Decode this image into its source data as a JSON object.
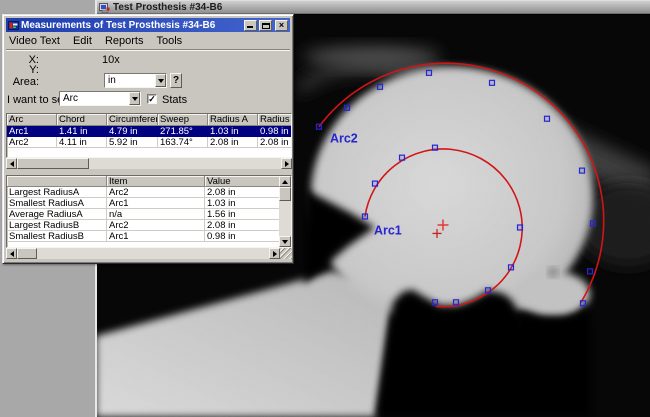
{
  "mdi_window": {
    "title": "Test Prosthesis #34-B6"
  },
  "dialog": {
    "title": "Measurements of Test Prosthesis #34-B6",
    "menu_items": [
      "Video Text",
      "Edit",
      "Reports",
      "Tools"
    ],
    "coords_panel": {
      "x_label": "X:",
      "y_label": "Y:",
      "magnification": "10x",
      "area_label": "Area:",
      "area_unit": "in",
      "help_label": "?"
    },
    "view_row": {
      "label": "I want to see:",
      "selected": "Arc",
      "stats_label": "Stats",
      "stats_checked": true
    },
    "arc_table": {
      "headers": [
        "Arc",
        "Chord",
        "Circumferenc",
        "Sweep",
        "Radius A",
        "Radius B"
      ],
      "rows": [
        {
          "cells": [
            "Arc1",
            "1.41 in",
            "4.79 in",
            "271.85°",
            "1.03 in",
            "0.98 in"
          ],
          "selected": true
        },
        {
          "cells": [
            "Arc2",
            "4.11 in",
            "5.92 in",
            "163.74°",
            "2.08 in",
            "2.08 in"
          ],
          "selected": false
        }
      ]
    },
    "stats_table": {
      "headers": [
        "",
        "Item",
        "Value"
      ],
      "rows": [
        [
          "Largest RadiusA",
          "Arc2",
          "2.08 in"
        ],
        [
          "Smallest RadiusA",
          "Arc1",
          "1.03 in"
        ],
        [
          "Average RadiusA",
          "n/a",
          "1.56 in"
        ],
        [
          "Largest RadiusB",
          "Arc2",
          "2.08 in"
        ],
        [
          "Smallest RadiusB",
          "Arc1",
          "0.98 in"
        ]
      ]
    }
  },
  "overlay": {
    "arc1_label": "Arc1",
    "arc2_label": "Arc2"
  },
  "icons": {
    "check": "✓",
    "close": "×"
  },
  "colors": {
    "dialog_titlebar_start": "#1f3dae",
    "dialog_titlebar_end": "#4365cd",
    "selection_bg": "#000080",
    "arc_stroke": "#d21414",
    "marker_blue": "#2424d0",
    "overlay_label_blue": "#2222cf"
  }
}
